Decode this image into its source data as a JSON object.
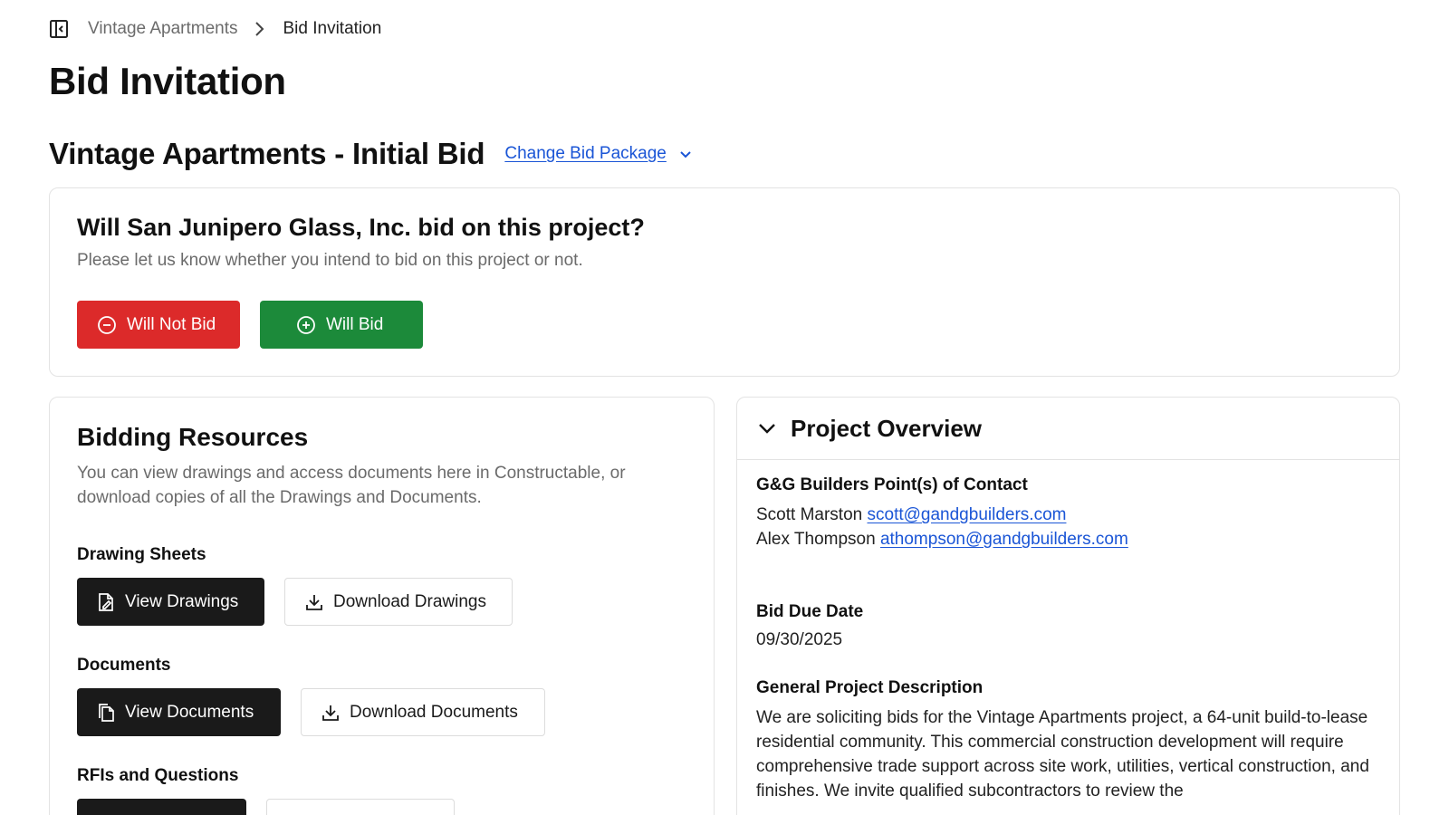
{
  "breadcrumb": {
    "parent": "Vintage Apartments",
    "current": "Bid Invitation"
  },
  "page": {
    "title": "Bid Invitation"
  },
  "package": {
    "title": "Vintage Apartments - Initial Bid",
    "change_label": "Change Bid Package"
  },
  "bid_prompt": {
    "question": "Will San Junipero Glass, Inc. bid on this project?",
    "subtitle": "Please let us know whether you intend to bid on this project or not.",
    "will_not_bid_label": "Will Not Bid",
    "will_bid_label": "Will Bid"
  },
  "resources": {
    "title": "Bidding Resources",
    "subtitle": "You can view drawings and access documents here in Constructable, or download copies of all the Drawings and Documents.",
    "drawings": {
      "label": "Drawing Sheets",
      "view_label": "View Drawings",
      "download_label": "Download Drawings"
    },
    "documents": {
      "label": "Documents",
      "view_label": "View Documents",
      "download_label": "Download Documents"
    },
    "rfis": {
      "label": "RFIs and Questions"
    }
  },
  "overview": {
    "title": "Project Overview",
    "contact_label": "G&G Builders Point(s) of Contact",
    "contacts": [
      {
        "name": "Scott Marston",
        "email": "scott@gandgbuilders.com"
      },
      {
        "name": "Alex Thompson",
        "email": "athompson@gandgbuilders.com"
      }
    ],
    "due_label": "Bid Due Date",
    "due_date": "09/30/2025",
    "description_label": "General Project Description",
    "description": "We are soliciting bids for the Vintage Apartments project, a 64-unit build-to-lease residential community. This commercial construction development will require comprehensive trade support across site work, utilities, vertical construction, and finishes. We invite qualified subcontractors to review the"
  },
  "colors": {
    "link": "#1a55d6",
    "danger": "#dc2a2a",
    "success": "#1c8a3a",
    "dark": "#1a1a1a"
  },
  "icons": [
    "sidebar-toggle-icon",
    "chevron-right-icon",
    "chevron-down-icon",
    "minus-circle-icon",
    "plus-circle-icon",
    "drawing-file-icon",
    "download-icon",
    "documents-icon"
  ]
}
